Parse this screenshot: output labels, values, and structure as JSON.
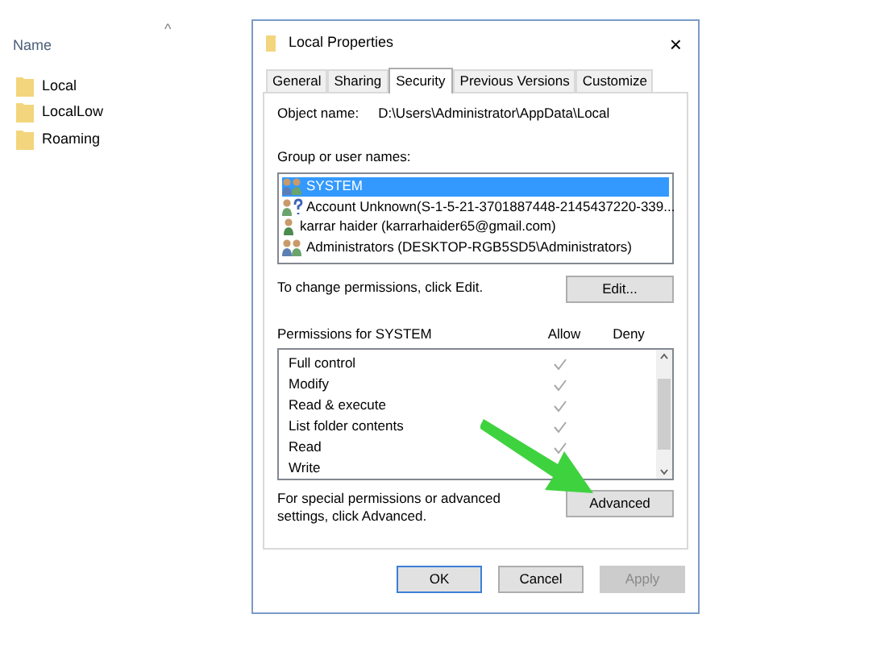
{
  "explorer": {
    "column_header": "Name",
    "sort_glyph": "^",
    "items": [
      {
        "name": "Local"
      },
      {
        "name": "LocalLow"
      },
      {
        "name": "Roaming"
      }
    ]
  },
  "dialog": {
    "title": "Local Properties",
    "close": "×",
    "tabs": [
      {
        "label": "General",
        "selected": false
      },
      {
        "label": "Sharing",
        "selected": false
      },
      {
        "label": "Security",
        "selected": true
      },
      {
        "label": "Previous Versions",
        "selected": false
      },
      {
        "label": "Customize",
        "selected": false
      }
    ],
    "object_label": "Object name:",
    "object_value": "D:\\Users\\Administrator\\AppData\\Local",
    "group_label": "Group or user names:",
    "principals": [
      {
        "name": "SYSTEM",
        "kind": "group",
        "selected": true
      },
      {
        "name": "Account Unknown(S-1-5-21-3701887448-2145437220-339...",
        "kind": "unknown",
        "selected": false
      },
      {
        "name": "karrar haider (karrarhaider65@gmail.com)",
        "kind": "user",
        "selected": false
      },
      {
        "name": "Administrators (DESKTOP-RGB5SD5\\Administrators)",
        "kind": "group",
        "selected": false
      }
    ],
    "change_text": "To change permissions, click Edit.",
    "edit_button": "Edit...",
    "permissions_label": "Permissions for SYSTEM",
    "allow_header": "Allow",
    "deny_header": "Deny",
    "permissions": [
      {
        "name": "Full control",
        "allow": true
      },
      {
        "name": "Modify",
        "allow": true
      },
      {
        "name": "Read & execute",
        "allow": true
      },
      {
        "name": "List folder contents",
        "allow": true
      },
      {
        "name": "Read",
        "allow": true
      },
      {
        "name": "Write"
      }
    ],
    "advanced_text": "For special permissions or advanced settings, click Advanced.",
    "advanced_button": "Advanced",
    "buttons": [
      {
        "label": "OK",
        "kind": "default"
      },
      {
        "label": "Cancel",
        "kind": "normal"
      },
      {
        "label": "Apply",
        "kind": "disabled"
      }
    ]
  }
}
